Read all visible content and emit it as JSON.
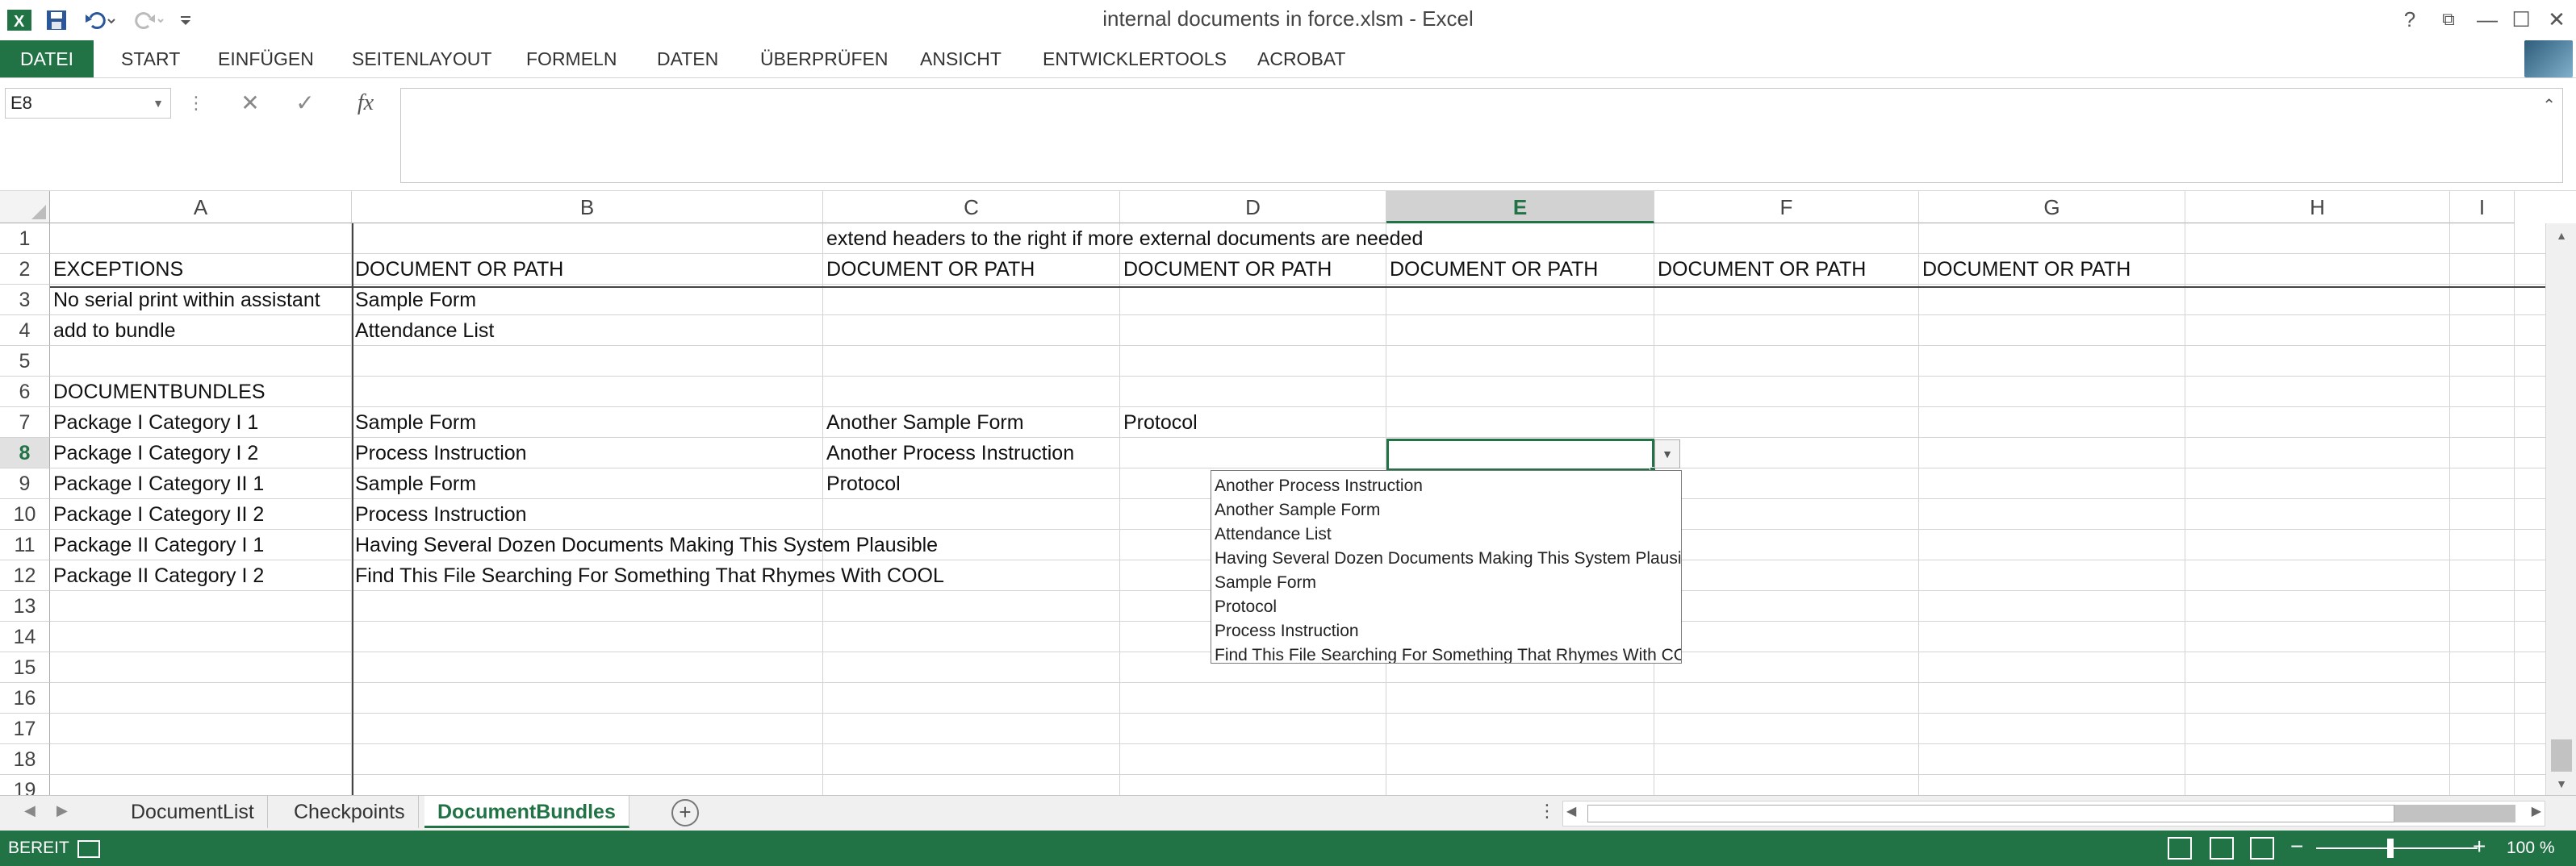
{
  "window": {
    "title": "internal documents in force.xlsm - Excel",
    "controls": {
      "help": "?",
      "ribbon_display": "⧉",
      "minimize": "—",
      "maximize": "☐",
      "close": "✕"
    }
  },
  "ribbon": {
    "tabs": [
      "DATEI",
      "START",
      "EINFÜGEN",
      "SEITENLAYOUT",
      "FORMELN",
      "DATEN",
      "ÜBERPRÜFEN",
      "ANSICHT",
      "ENTWICKLERTOOLS",
      "ACROBAT"
    ]
  },
  "formula_bar": {
    "name_box": "E8",
    "fx": "fx",
    "cancel": "✕",
    "enter": "✓",
    "value": ""
  },
  "columns": [
    "A",
    "B",
    "C",
    "D",
    "E",
    "F",
    "G",
    "H",
    "I"
  ],
  "active_column": "E",
  "active_row": "8",
  "rows": [
    "1",
    "2",
    "3",
    "4",
    "5",
    "6",
    "7",
    "8",
    "9",
    "10",
    "11",
    "12",
    "13",
    "14",
    "15",
    "16",
    "17",
    "18",
    "19"
  ],
  "cells": {
    "C1": "extend headers to the right if more external documents are needed",
    "A2": "EXCEPTIONS",
    "B2": "DOCUMENT OR PATH",
    "C2": "DOCUMENT OR PATH",
    "D2": "DOCUMENT OR PATH",
    "E2": "DOCUMENT OR PATH",
    "F2": "DOCUMENT OR PATH",
    "G2": "DOCUMENT OR PATH",
    "A3": "No serial print within assistant",
    "B3": "Sample Form",
    "A4": "add to bundle",
    "B4": "Attendance List",
    "A6": "DOCUMENTBUNDLES",
    "A7": "Package I Category I 1",
    "B7": "Sample Form",
    "C7": "Another Sample Form",
    "D7": "Protocol",
    "A8": "Package I Category I 2",
    "B8": "Process Instruction",
    "C8": "Another Process Instruction",
    "A9": "Package I Category II 1",
    "B9": "Sample Form",
    "C9": "Protocol",
    "A10": "Package I Category II 2",
    "B10": "Process Instruction",
    "A11": "Package II Category I 1",
    "B11": "Having Several Dozen Documents Making This System Plausible",
    "A12": "Package II Category I 2",
    "B12": "Find This File Searching For Something That Rhymes With COOL"
  },
  "dropdown": {
    "items": [
      "Another Process Instruction",
      "Another Sample Form",
      "Attendance List",
      "Having Several Dozen Documents Making This System Plausible",
      "Sample Form",
      "Protocol",
      "Process Instruction",
      "Find This File Searching For Something That Rhymes With COOL"
    ]
  },
  "sheets": {
    "tabs": [
      "DocumentList",
      "Checkpoints",
      "DocumentBundles"
    ],
    "active": "DocumentBundles"
  },
  "status": {
    "text": "BEREIT",
    "zoom": "100 %",
    "zoom_minus": "−",
    "zoom_plus": "+"
  },
  "colors": {
    "accent": "#217346"
  }
}
